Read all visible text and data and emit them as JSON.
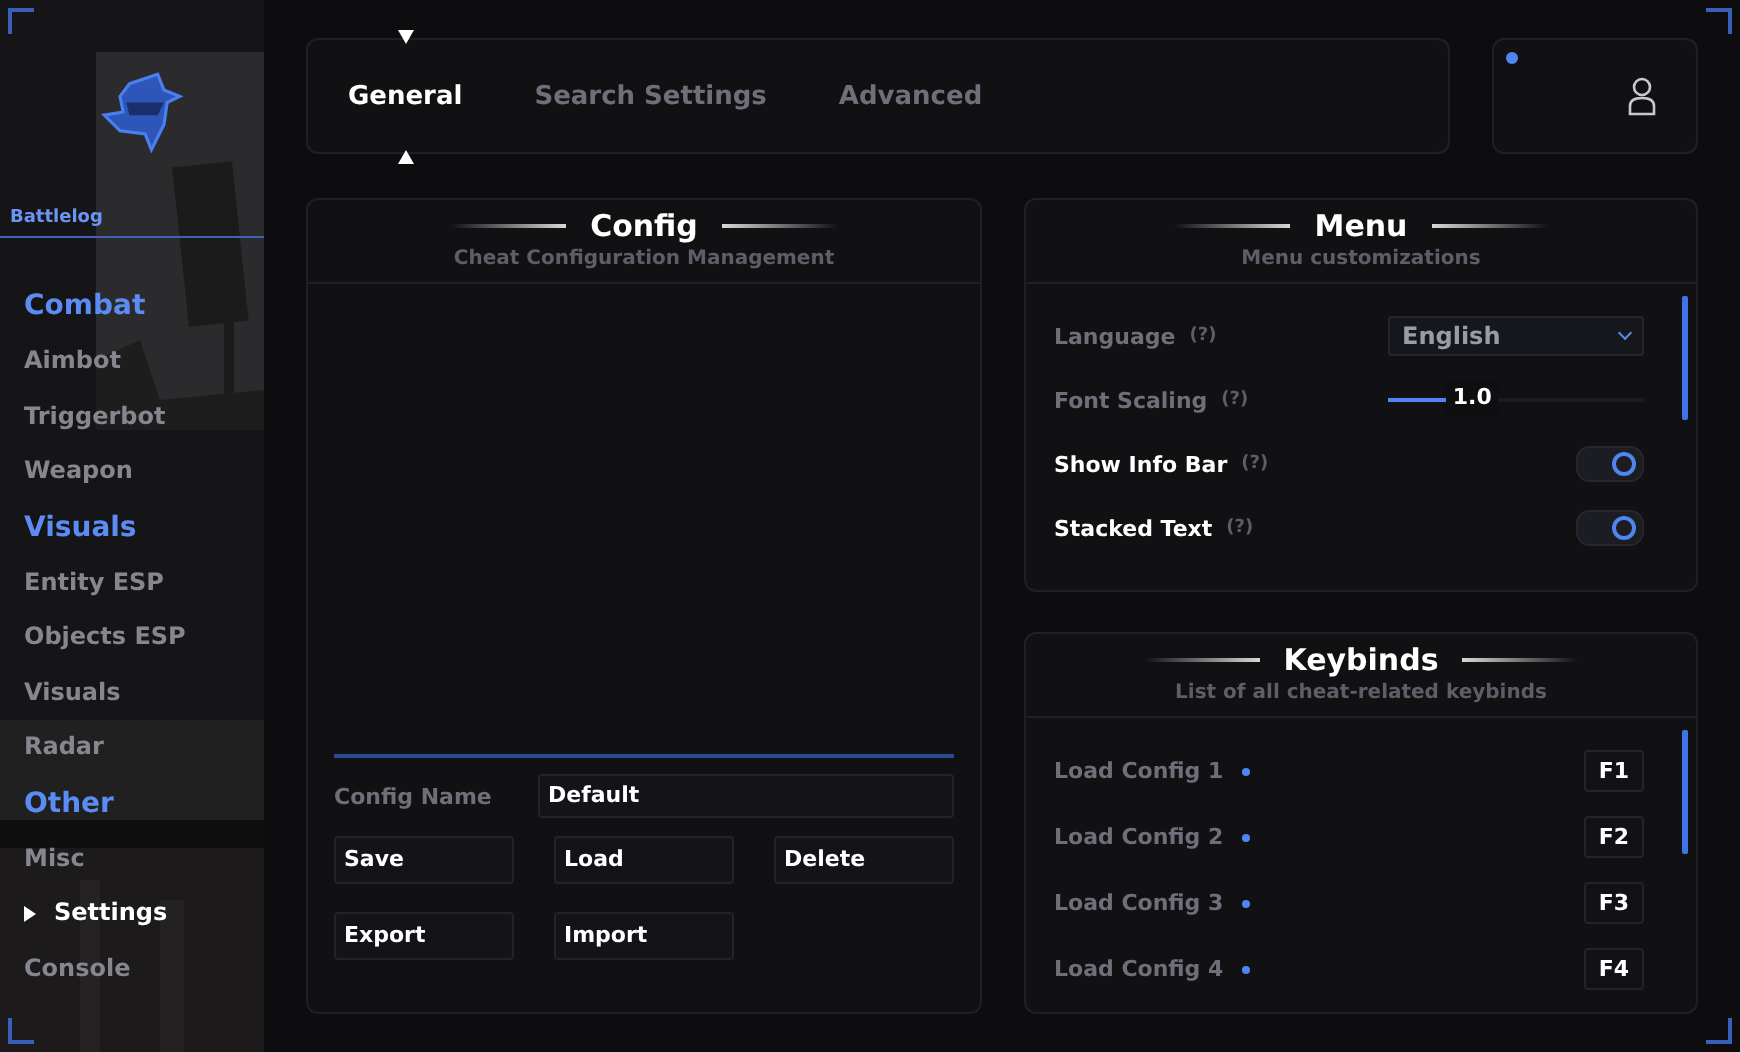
{
  "sidebar": {
    "brand": "Battlelog",
    "sections": [
      {
        "title": "Combat",
        "items": [
          {
            "label": "Aimbot",
            "selected": false
          },
          {
            "label": "Triggerbot",
            "selected": false
          },
          {
            "label": "Weapon",
            "selected": false
          }
        ]
      },
      {
        "title": "Visuals",
        "items": [
          {
            "label": "Entity ESP",
            "selected": false
          },
          {
            "label": "Objects ESP",
            "selected": false
          },
          {
            "label": "Visuals",
            "selected": false
          },
          {
            "label": "Radar",
            "selected": false
          }
        ]
      },
      {
        "title": "Other",
        "items": [
          {
            "label": "Misc",
            "selected": false
          },
          {
            "label": "Settings",
            "selected": true
          },
          {
            "label": "Console",
            "selected": false
          }
        ]
      }
    ]
  },
  "tabs": [
    {
      "label": "General",
      "selected": true
    },
    {
      "label": "Search Settings",
      "selected": false
    },
    {
      "label": "Advanced",
      "selected": false
    }
  ],
  "config": {
    "title": "Config",
    "subtitle": "Cheat Configuration Management",
    "name_label": "Config Name",
    "name_value": "Default",
    "buttons": [
      "Save",
      "Load",
      "Delete",
      "Export",
      "Import"
    ]
  },
  "menu": {
    "title": "Menu",
    "subtitle": "Menu customizations",
    "settings": [
      {
        "kind": "dropdown",
        "label": "Language",
        "hint": "(?)",
        "disabled": true,
        "value": "English"
      },
      {
        "kind": "slider",
        "label": "Font Scaling",
        "hint": "(?)",
        "disabled": true,
        "level": 0.3,
        "reading": "1.0"
      },
      {
        "kind": "toggle",
        "label": "Show Info Bar",
        "hint": "(?)",
        "disabled": false,
        "on": true
      },
      {
        "kind": "toggle",
        "label": "Stacked Text",
        "hint": "(?)",
        "disabled": false,
        "on": true
      }
    ]
  },
  "keybinds": {
    "title": "Keybinds",
    "subtitle": "List of all cheat-related keybinds",
    "items": [
      {
        "label": "Load Config 1",
        "key": "F1"
      },
      {
        "label": "Load Config 2",
        "key": "F2"
      },
      {
        "label": "Load Config 3",
        "key": "F3"
      },
      {
        "label": "Load Config 4",
        "key": "F4"
      }
    ]
  }
}
